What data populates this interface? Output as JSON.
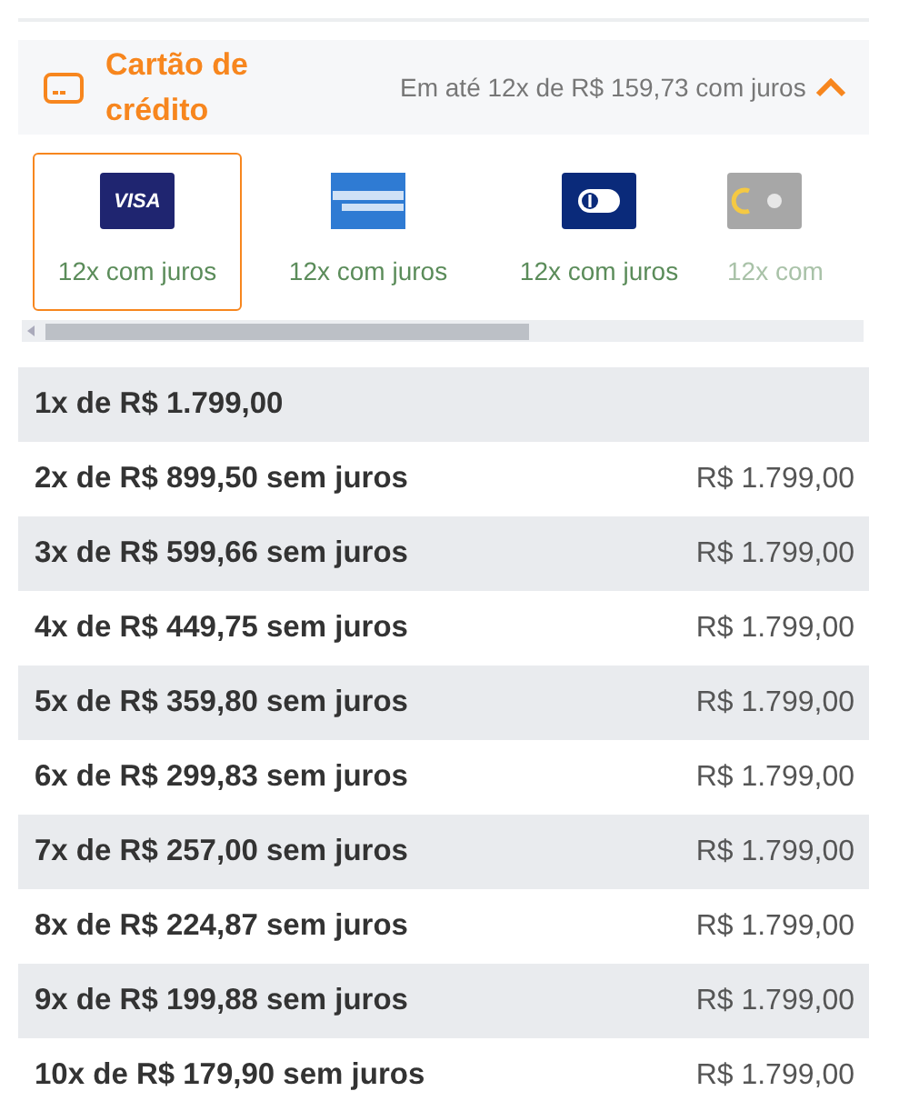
{
  "payment_method": {
    "title": "Cartão de crédito",
    "summary": "Em até 12x de R$ 159,73 com juros",
    "expanded": true
  },
  "cards": [
    {
      "kind": "visa",
      "logo_text": "VISA",
      "label": "12x com juros",
      "selected": true
    },
    {
      "kind": "amex",
      "label": "12x com juros",
      "selected": false
    },
    {
      "kind": "diners",
      "label": "12x com juros",
      "selected": false
    },
    {
      "kind": "elo",
      "label": "12x com",
      "selected": false
    }
  ],
  "installments": [
    {
      "plan": "1x de R$ 1.799,00"
    },
    {
      "plan": "2x de R$ 899,50 sem juros",
      "total": "R$ 1.799,00"
    },
    {
      "plan": "3x de R$ 599,66 sem juros",
      "total": "R$ 1.799,00"
    },
    {
      "plan": "4x de R$ 449,75 sem juros",
      "total": "R$ 1.799,00"
    },
    {
      "plan": "5x de R$ 359,80 sem juros",
      "total": "R$ 1.799,00"
    },
    {
      "plan": "6x de R$ 299,83 sem juros",
      "total": "R$ 1.799,00"
    },
    {
      "plan": "7x de R$ 257,00 sem juros",
      "total": "R$ 1.799,00"
    },
    {
      "plan": "8x de R$ 224,87 sem juros",
      "total": "R$ 1.799,00"
    },
    {
      "plan": "9x de R$ 199,88 sem juros",
      "total": "R$ 1.799,00"
    },
    {
      "plan": "10x de R$ 179,90 sem juros",
      "total": "R$ 1.799,00"
    }
  ]
}
